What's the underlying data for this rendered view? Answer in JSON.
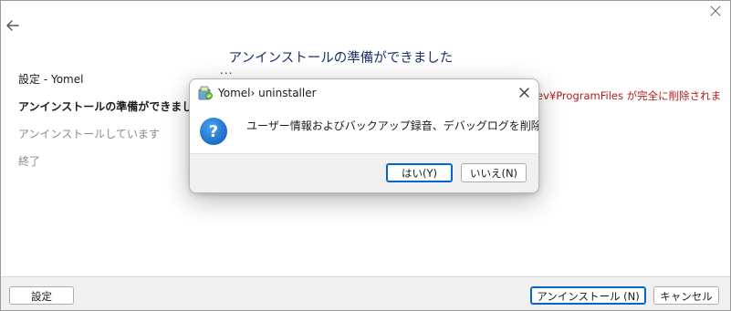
{
  "window": {
    "heading": "アンインストールの準備ができました",
    "ellipsis": "...",
    "path_text": "ev¥ProgramFiles が完全に削除されま"
  },
  "sidebar": {
    "steps": [
      {
        "label": "設定 - Yomel",
        "state": "done"
      },
      {
        "label": "アンインストールの準備ができました",
        "state": "active"
      },
      {
        "label": "アンインストールしています",
        "state": "pending"
      },
      {
        "label": "終了",
        "state": "pending"
      }
    ]
  },
  "footer": {
    "settings_label": "設定",
    "install_label": "アンインストール (N)",
    "cancel_label": "キャンセル"
  },
  "dialog": {
    "title": "Yomel› uninstaller",
    "message": "ユーザー情報およびバックアップ録音、デバッグログを削除しますか？",
    "yes_label": "はい(Y)",
    "no_label": "いいえ(N)"
  },
  "colors": {
    "accent": "#0066cc",
    "heading": "#1a2f64",
    "warning_text": "#b01a1a",
    "question_icon": "#1f7bd6"
  },
  "icons": {
    "back": "arrow-left-icon",
    "close": "close-icon",
    "app": "installer-icon",
    "question": "question-icon"
  }
}
